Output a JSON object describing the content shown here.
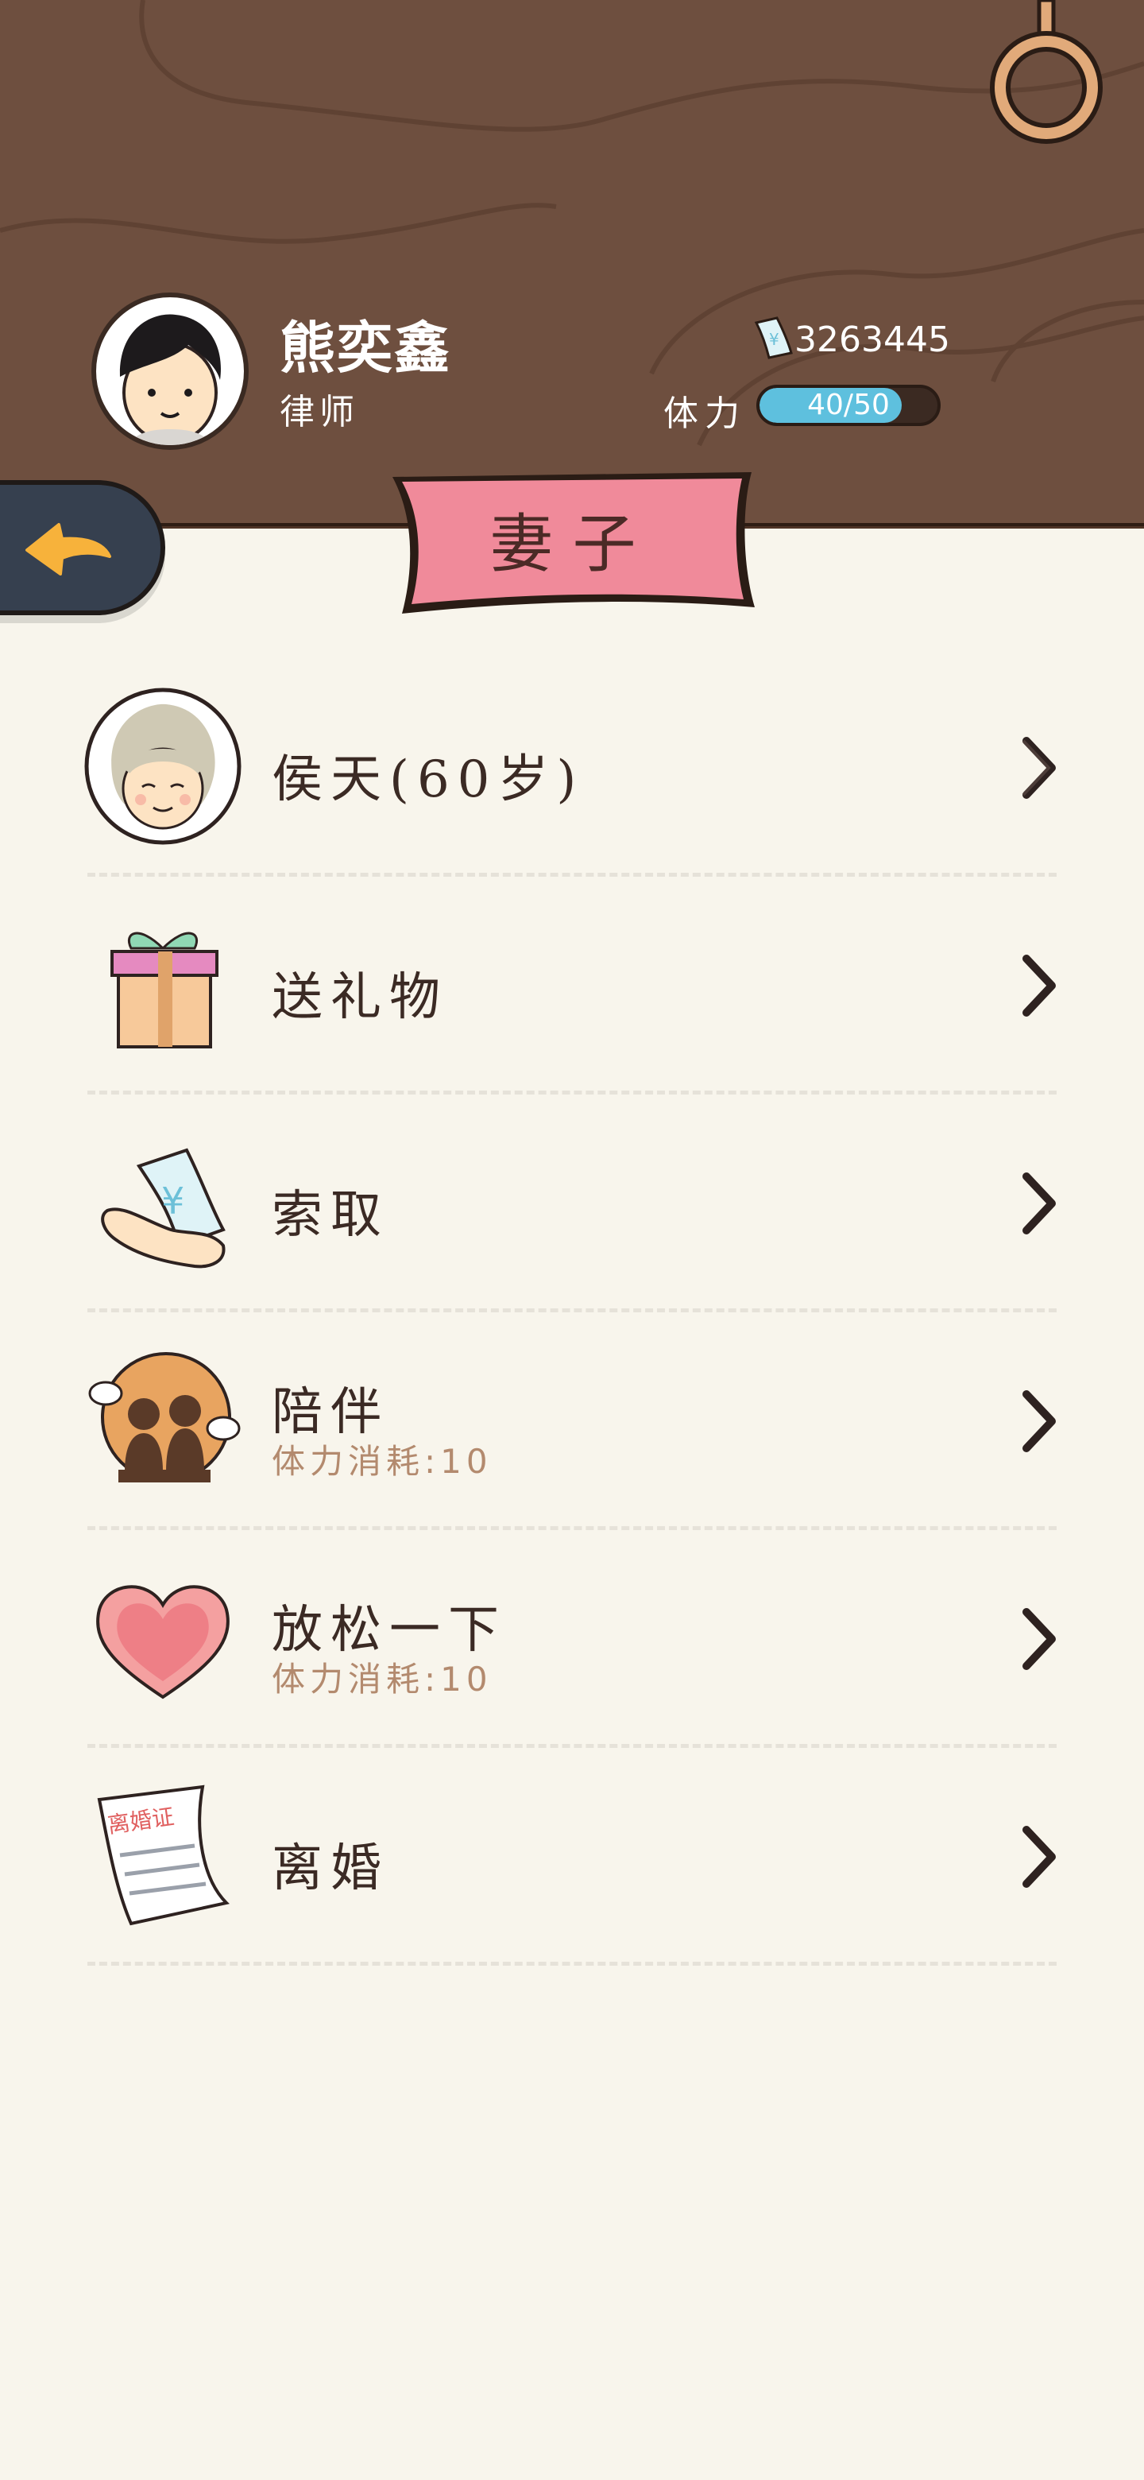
{
  "player": {
    "name": "熊奕鑫",
    "job": "律师",
    "money": "3263445",
    "stamina_label": "体力",
    "stamina_text": "40/50",
    "stamina_fraction": 0.8
  },
  "page": {
    "title": "妻子"
  },
  "menu": [
    {
      "label": "侯天(60岁)",
      "sub": "",
      "icon": "elderly-woman-portrait-icon"
    },
    {
      "label": "送礼物",
      "sub": "",
      "icon": "gift-box-icon"
    },
    {
      "label": "索取",
      "sub": "",
      "icon": "hand-money-icon"
    },
    {
      "label": "陪伴",
      "sub": "体力消耗:10",
      "icon": "couple-silhouette-icon"
    },
    {
      "label": "放松一下",
      "sub": "体力消耗:10",
      "icon": "heart-icon"
    },
    {
      "label": "离婚",
      "sub": "",
      "icon": "divorce-certificate-icon"
    }
  ],
  "certificate_text": "离婚证",
  "colors": {
    "wood": "#6e4f3f",
    "ribbon": "#f08a9a",
    "stamina": "#5ec0de",
    "background": "#f8f5ec",
    "back_button": "#36404f",
    "arrow": "#f7b23b"
  }
}
